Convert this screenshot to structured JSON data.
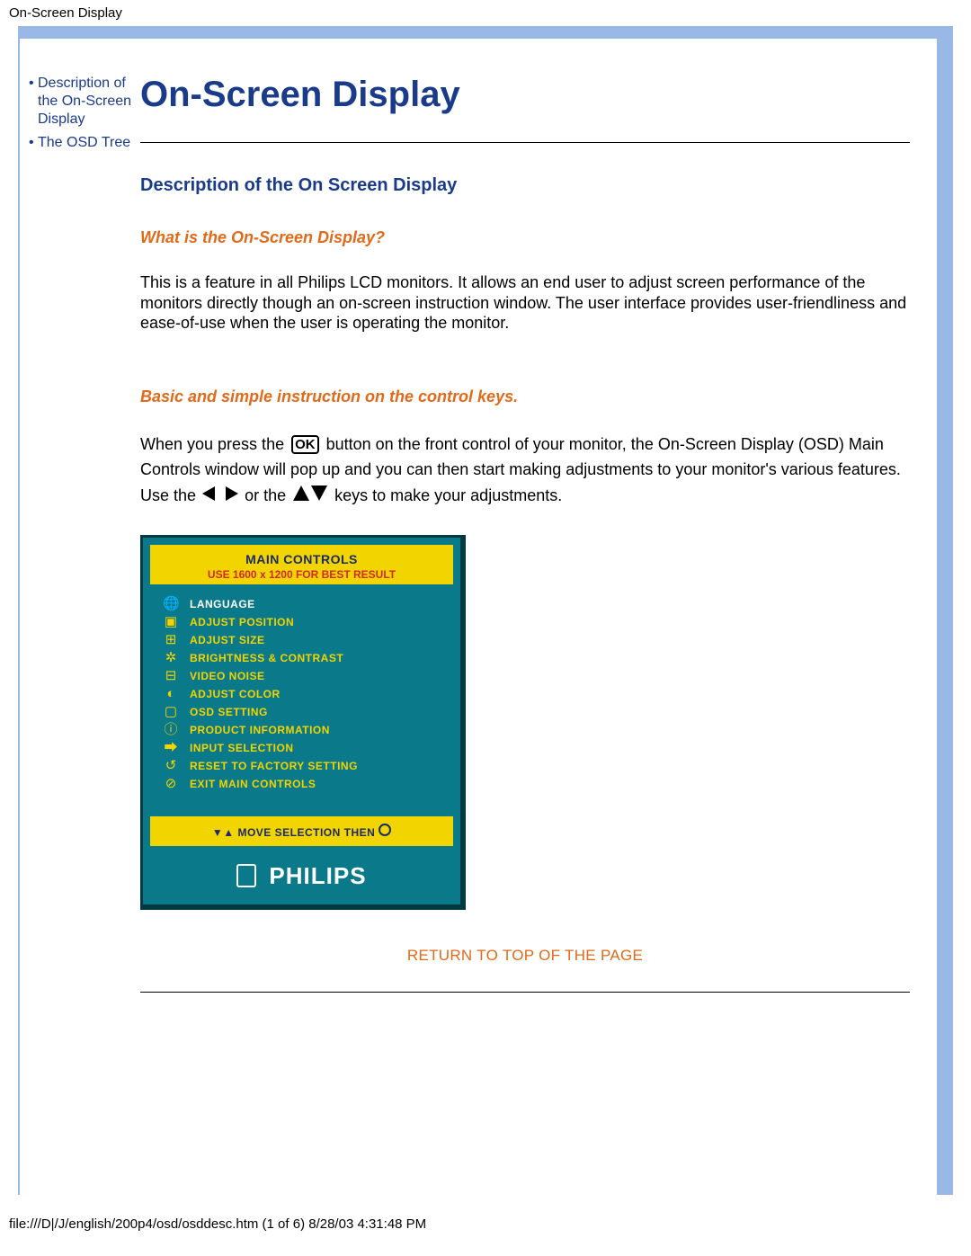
{
  "header": {
    "title": "On-Screen Display"
  },
  "sidebar": {
    "items": [
      {
        "bullet": "•",
        "label": "Description of the On-Screen Display"
      },
      {
        "bullet": "•",
        "label": "The OSD Tree"
      }
    ]
  },
  "content": {
    "title": "On-Screen Display",
    "section_heading": "Description of the On Screen Display",
    "q1": "What is the On-Screen Display?",
    "p1": "This is a feature in all Philips LCD monitors. It allows an end user to adjust screen performance of the monitors directly though an on-screen instruction window. The user interface provides user-friendliness and ease-of-use when the user is operating the monitor.",
    "q2": "Basic and simple instruction on the control keys.",
    "p2a": "When you press the ",
    "ok_label": "OK",
    "p2b": " button on the front control of your monitor, the On-Screen Display (OSD) Main Controls window will pop up and you can then start making adjustments to your monitor's various features. Use the ",
    "p2c": " or the ",
    "p2d": " keys to make your adjustments.",
    "return_link": "RETURN TO TOP OF THE PAGE"
  },
  "osd": {
    "head1": "MAIN CONTROLS",
    "head2": "USE 1600 x 1200 FOR BEST RESULT",
    "items": [
      {
        "icon": "🌐",
        "label": "LANGUAGE",
        "selected": true
      },
      {
        "icon": "▣",
        "label": "ADJUST POSITION",
        "selected": false
      },
      {
        "icon": "⊞",
        "label": "ADJUST SIZE",
        "selected": false
      },
      {
        "icon": "✲",
        "label": "BRIGHTNESS & CONTRAST",
        "selected": false
      },
      {
        "icon": "⊟",
        "label": "VIDEO NOISE",
        "selected": false
      },
      {
        "icon": "◐",
        "label": "ADJUST COLOR",
        "selected": false
      },
      {
        "icon": "▢",
        "label": "OSD SETTING",
        "selected": false
      },
      {
        "icon": "ⓘ",
        "label": "PRODUCT INFORMATION",
        "selected": false
      },
      {
        "icon": "⮕",
        "label": "INPUT SELECTION",
        "selected": false
      },
      {
        "icon": "↺",
        "label": "RESET TO FACTORY SETTING",
        "selected": false
      },
      {
        "icon": "⊘",
        "label": "EXIT MAIN CONTROLS",
        "selected": false
      }
    ],
    "foot_instruction": "MOVE SELECTION THEN",
    "foot_icons_left": "▼▲",
    "foot_icon_right": "OK",
    "brand": "PHILIPS"
  },
  "footer": {
    "text": "file:///D|/J/english/200p4/osd/osddesc.htm (1 of 6) 8/28/03 4:31:48 PM"
  }
}
